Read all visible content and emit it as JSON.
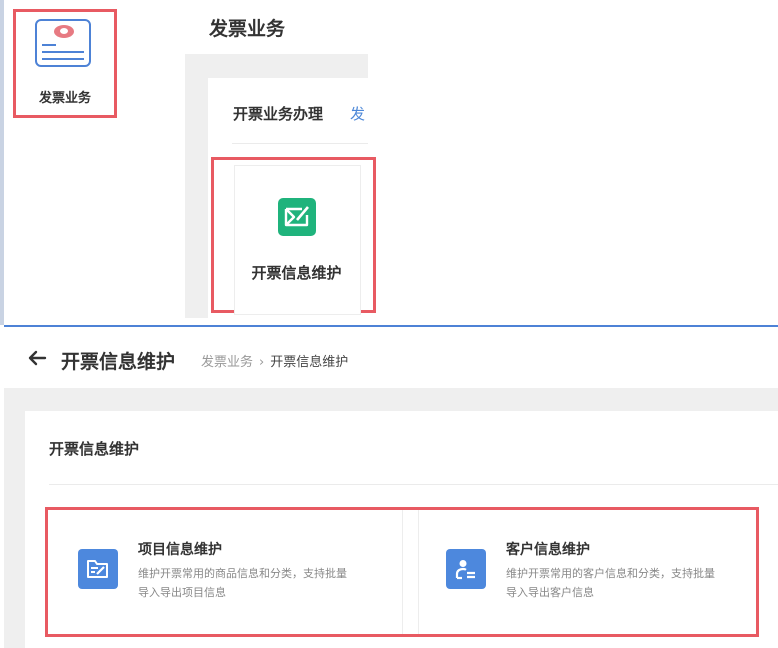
{
  "top": {
    "icon_label": "发票业务",
    "page_title": "发票业务",
    "tabs": [
      {
        "label": "开票业务办理"
      },
      {
        "label": "发"
      }
    ],
    "card_label": "开票信息维护"
  },
  "header": {
    "title": "开票信息维护",
    "breadcrumb": {
      "parent": "发票业务",
      "separator": "›",
      "current": "开票信息维护"
    }
  },
  "section": {
    "title": "开票信息维护",
    "cards": [
      {
        "title": "项目信息维护",
        "desc_line1": "维护开票常用的商品信息和分类，支持批量",
        "desc_line2": "导入导出项目信息",
        "icon": "folder-edit-icon"
      },
      {
        "title": "客户信息维护",
        "desc_line1": "维护开票常用的客户信息和分类，支持批量",
        "desc_line2": "导入导出客户信息",
        "icon": "customer-card-icon"
      }
    ]
  },
  "colors": {
    "highlight": "#e85a62",
    "accent_blue": "#4d88dd",
    "accent_green": "#1fb37c"
  }
}
